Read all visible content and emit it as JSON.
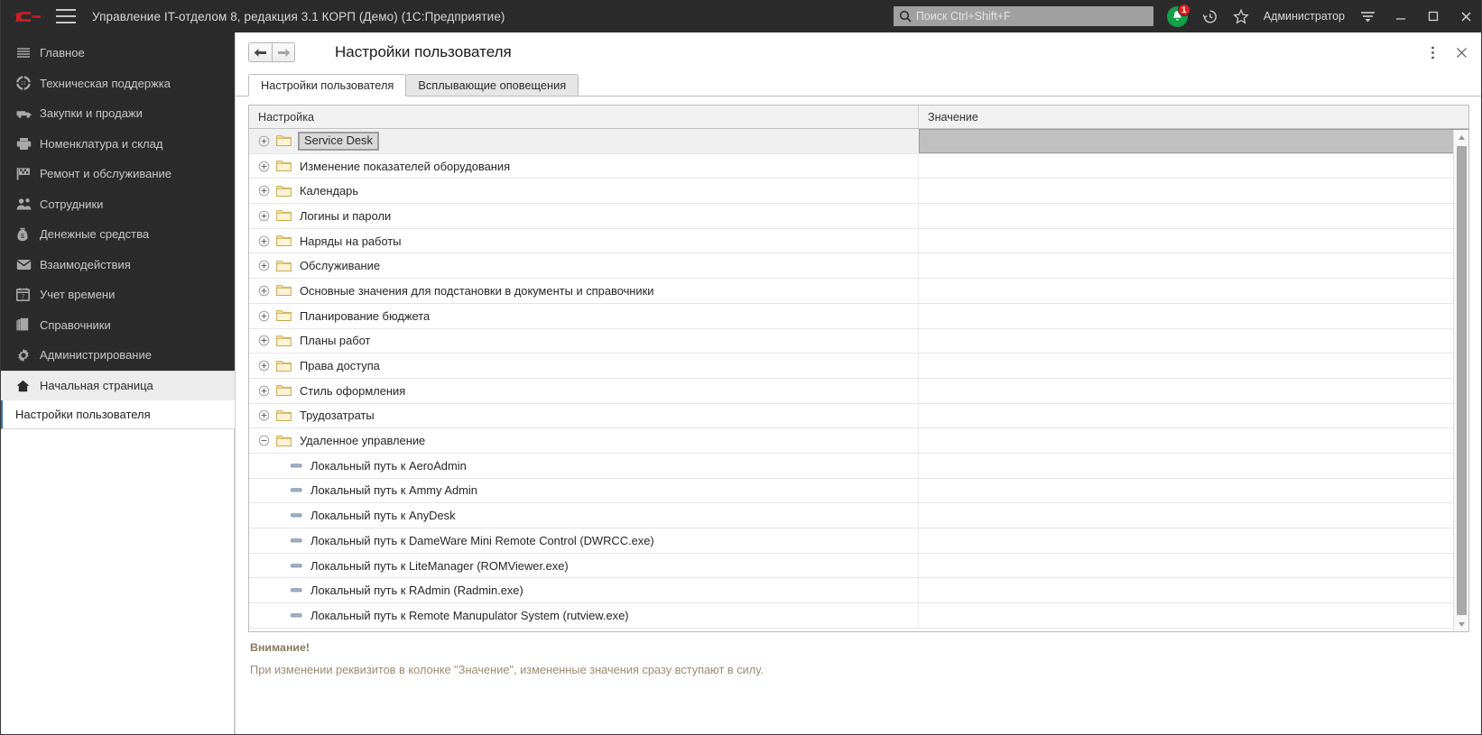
{
  "titlebar": {
    "logo": "1c-logo",
    "menu_icon": "hamburger-menu-icon",
    "title": "Управление IT-отделом 8, редакция 3.1 КОРП (Демо)  (1С:Предприятие)",
    "search_placeholder": "Поиск Ctrl+Shift+F",
    "search_value": "",
    "notification_count": "1",
    "user": "Администратор",
    "icons": [
      "bell-icon",
      "history-clock-icon",
      "star-favorites-icon",
      "main-menu-icon"
    ],
    "window_controls": [
      "minimize-button",
      "maximize-button",
      "close-button"
    ]
  },
  "sidebar": {
    "items": [
      {
        "label": "Главное",
        "icon": "lines-icon"
      },
      {
        "label": "Техническая поддержка",
        "icon": "support-wheel-icon"
      },
      {
        "label": "Закупки и продажи",
        "icon": "truck-icon"
      },
      {
        "label": "Номенклатура и склад",
        "icon": "printer-box-icon"
      },
      {
        "label": "Ремонт и обслуживание",
        "icon": "flag-tools-icon"
      },
      {
        "label": "Сотрудники",
        "icon": "people-icon"
      },
      {
        "label": "Денежные средства",
        "icon": "money-bag-icon"
      },
      {
        "label": "Взаимодействия",
        "icon": "envelope-icon"
      },
      {
        "label": "Учет времени",
        "icon": "calendar-icon"
      },
      {
        "label": "Справочники",
        "icon": "books-icon"
      },
      {
        "label": "Администрирование",
        "icon": "gear-icon"
      }
    ],
    "home": {
      "label": "Начальная страница",
      "icon": "home-icon"
    },
    "current": {
      "label": "Настройки пользователя"
    }
  },
  "main": {
    "nav_back": "back-arrow",
    "nav_forward": "forward-arrow",
    "page_title": "Настройки пользователя",
    "more_icon": "more-vertical-icon",
    "close_icon": "close-icon",
    "tabs": [
      {
        "label": "Настройки пользователя",
        "active": true
      },
      {
        "label": "Всплывающие оповещения",
        "active": false
      }
    ],
    "table": {
      "columns": [
        "Настройка",
        "Значение"
      ],
      "rows": [
        {
          "label": "Service Desk",
          "type": "folder",
          "state": "collapsed",
          "selected": true,
          "value": ""
        },
        {
          "label": "Изменение показателей оборудования",
          "type": "folder",
          "state": "collapsed",
          "selected": false,
          "value": ""
        },
        {
          "label": "Календарь",
          "type": "folder",
          "state": "collapsed",
          "selected": false,
          "value": ""
        },
        {
          "label": "Логины и пароли",
          "type": "folder",
          "state": "collapsed",
          "selected": false,
          "value": ""
        },
        {
          "label": "Наряды на работы",
          "type": "folder",
          "state": "collapsed",
          "selected": false,
          "value": ""
        },
        {
          "label": "Обслуживание",
          "type": "folder",
          "state": "collapsed",
          "selected": false,
          "value": ""
        },
        {
          "label": "Основные значения для подстановки в документы и справочники",
          "type": "folder",
          "state": "collapsed",
          "selected": false,
          "value": ""
        },
        {
          "label": "Планирование бюджета",
          "type": "folder",
          "state": "collapsed",
          "selected": false,
          "value": ""
        },
        {
          "label": "Планы работ",
          "type": "folder",
          "state": "collapsed",
          "selected": false,
          "value": ""
        },
        {
          "label": "Права доступа",
          "type": "folder",
          "state": "collapsed",
          "selected": false,
          "value": ""
        },
        {
          "label": "Стиль оформления",
          "type": "folder",
          "state": "collapsed",
          "selected": false,
          "value": ""
        },
        {
          "label": "Трудозатраты",
          "type": "folder",
          "state": "collapsed",
          "selected": false,
          "value": ""
        },
        {
          "label": "Удаленное управление",
          "type": "folder",
          "state": "expanded",
          "selected": false,
          "value": ""
        },
        {
          "label": "Локальный путь к AeroAdmin",
          "type": "leaf",
          "state": "",
          "selected": false,
          "value": ""
        },
        {
          "label": "Локальный путь к Ammy Admin",
          "type": "leaf",
          "state": "",
          "selected": false,
          "value": ""
        },
        {
          "label": "Локальный путь к AnyDesk",
          "type": "leaf",
          "state": "",
          "selected": false,
          "value": ""
        },
        {
          "label": "Локальный путь к DameWare Mini Remote Control (DWRCC.exe)",
          "type": "leaf",
          "state": "",
          "selected": false,
          "value": ""
        },
        {
          "label": "Локальный путь к LiteManager (ROMViewer.exe)",
          "type": "leaf",
          "state": "",
          "selected": false,
          "value": ""
        },
        {
          "label": "Локальный путь к RAdmin (Radmin.exe)",
          "type": "leaf",
          "state": "",
          "selected": false,
          "value": ""
        },
        {
          "label": "Локальный путь к Remote Manupulator System (rutview.exe)",
          "type": "leaf",
          "state": "",
          "selected": false,
          "value": ""
        }
      ]
    },
    "warning": {
      "title": "Внимание!",
      "text": "При изменении реквизитов в колонке \"Значение\", измененные значения сразу вступают в силу."
    }
  },
  "colors": {
    "titlebar_bg": "#2b2b2b",
    "accent_blue": "#2f6fba",
    "brand_red": "#cc2027",
    "notification_green": "#15a04a",
    "badge_red": "#e02020",
    "warning_text": "#9b8c70"
  }
}
